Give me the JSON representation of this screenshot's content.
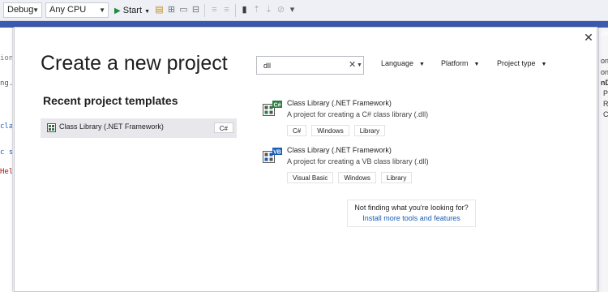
{
  "toolbar": {
    "config": "Debug",
    "platform": "Any CPU",
    "start_label": "Start",
    "start_icon": "play-icon",
    "colors": {
      "start_green": "#1e8a3a",
      "band_blue": "#3c5ab2"
    }
  },
  "editor": {
    "left_fragments": [
      "ions",
      "ng.",
      "class",
      "c st",
      "Hell"
    ],
    "right_fragments": [
      "plo",
      "on",
      "on",
      "nD",
      "Pr",
      "R",
      "C"
    ]
  },
  "dialog": {
    "close_icon": "close-icon",
    "title": "Create a new project",
    "recent_heading": "Recent project templates",
    "recent_items": [
      {
        "label": "Class Library (.NET Framework)",
        "language": "C#"
      }
    ],
    "search": {
      "value": "dll",
      "clear_icon": "close-icon",
      "dropdown_icon": "chevron-down-icon"
    },
    "filters": [
      {
        "label": "Language"
      },
      {
        "label": "Platform"
      },
      {
        "label": "Project type"
      }
    ],
    "results": [
      {
        "title": "Class Library (.NET Framework)",
        "description": "A project for creating a C# class library (.dll)",
        "badge": "C#",
        "tags": [
          "C#",
          "Windows",
          "Library"
        ]
      },
      {
        "title": "Class Library (.NET Framework)",
        "description": "A project for creating a VB class library (.dll)",
        "badge": "VB",
        "tags": [
          "Visual Basic",
          "Windows",
          "Library"
        ]
      }
    ],
    "not_finding": {
      "question": "Not finding what you're looking for?",
      "link": "Install more tools and features"
    }
  }
}
